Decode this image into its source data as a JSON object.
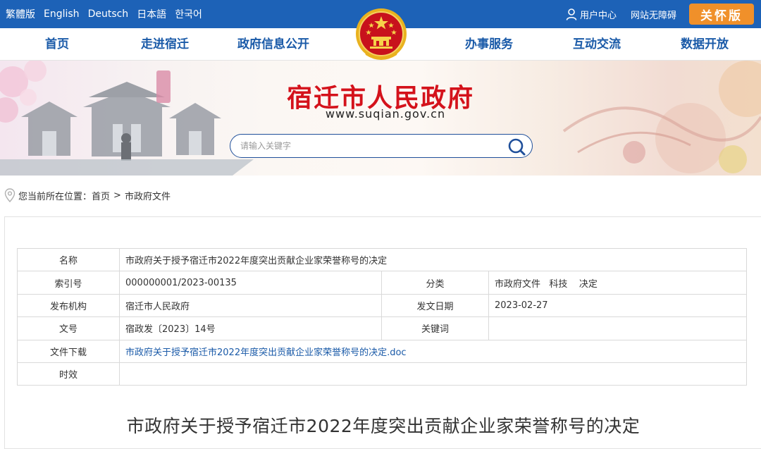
{
  "topbar": {
    "languages": [
      "繁體版",
      "English",
      "Deutsch",
      "日本語",
      "한국어"
    ],
    "user_center": "用户中心",
    "accessibility": "网站无障碍",
    "care_mode": "关怀版"
  },
  "nav": {
    "items": [
      "首页",
      "走进宿迁",
      "政府信息公开",
      "办事服务",
      "互动交流",
      "数据开放"
    ]
  },
  "banner": {
    "site_title": "宿迁市人民政府",
    "site_url": "www.suqian.gov.cn"
  },
  "search": {
    "placeholder": "请输入关键字"
  },
  "breadcrumb": {
    "prefix": "您当前所在位置：",
    "items": [
      "首页",
      "市政府文件"
    ],
    "separator": ">"
  },
  "meta": {
    "name_label": "名称",
    "name_value": "市政府关于授予宿迁市2022年度突出贡献企业家荣誉称号的决定",
    "index_label": "索引号",
    "index_value": "000000001/2023-00135",
    "category_label": "分类",
    "category_value": "市政府文件   科技    决定",
    "issuer_label": "发布机构",
    "issuer_value": "宿迁市人民政府",
    "date_label": "发文日期",
    "date_value": "2023-02-27",
    "doc_no_label": "文号",
    "doc_no_value": "宿政发〔2023〕14号",
    "keywords_label": "关键词",
    "keywords_value": "",
    "download_label": "文件下载",
    "download_value": "市政府关于授予宿迁市2022年度突出贡献企业家荣誉称号的决定.doc",
    "validity_label": "时效",
    "validity_value": ""
  },
  "document": {
    "title": "市政府关于授予宿迁市2022年度突出贡献企业家荣誉称号的决定"
  },
  "colors": {
    "topbar_bg": "#1d62b7",
    "nav_text": "#1a5aa8",
    "title_red": "#d4121b",
    "care_orange": "#f0902a",
    "link_blue": "#1a5aa8"
  },
  "icons": {
    "user": "user-icon",
    "emblem": "national-emblem-icon",
    "search": "search-icon",
    "location": "location-pin-icon"
  }
}
